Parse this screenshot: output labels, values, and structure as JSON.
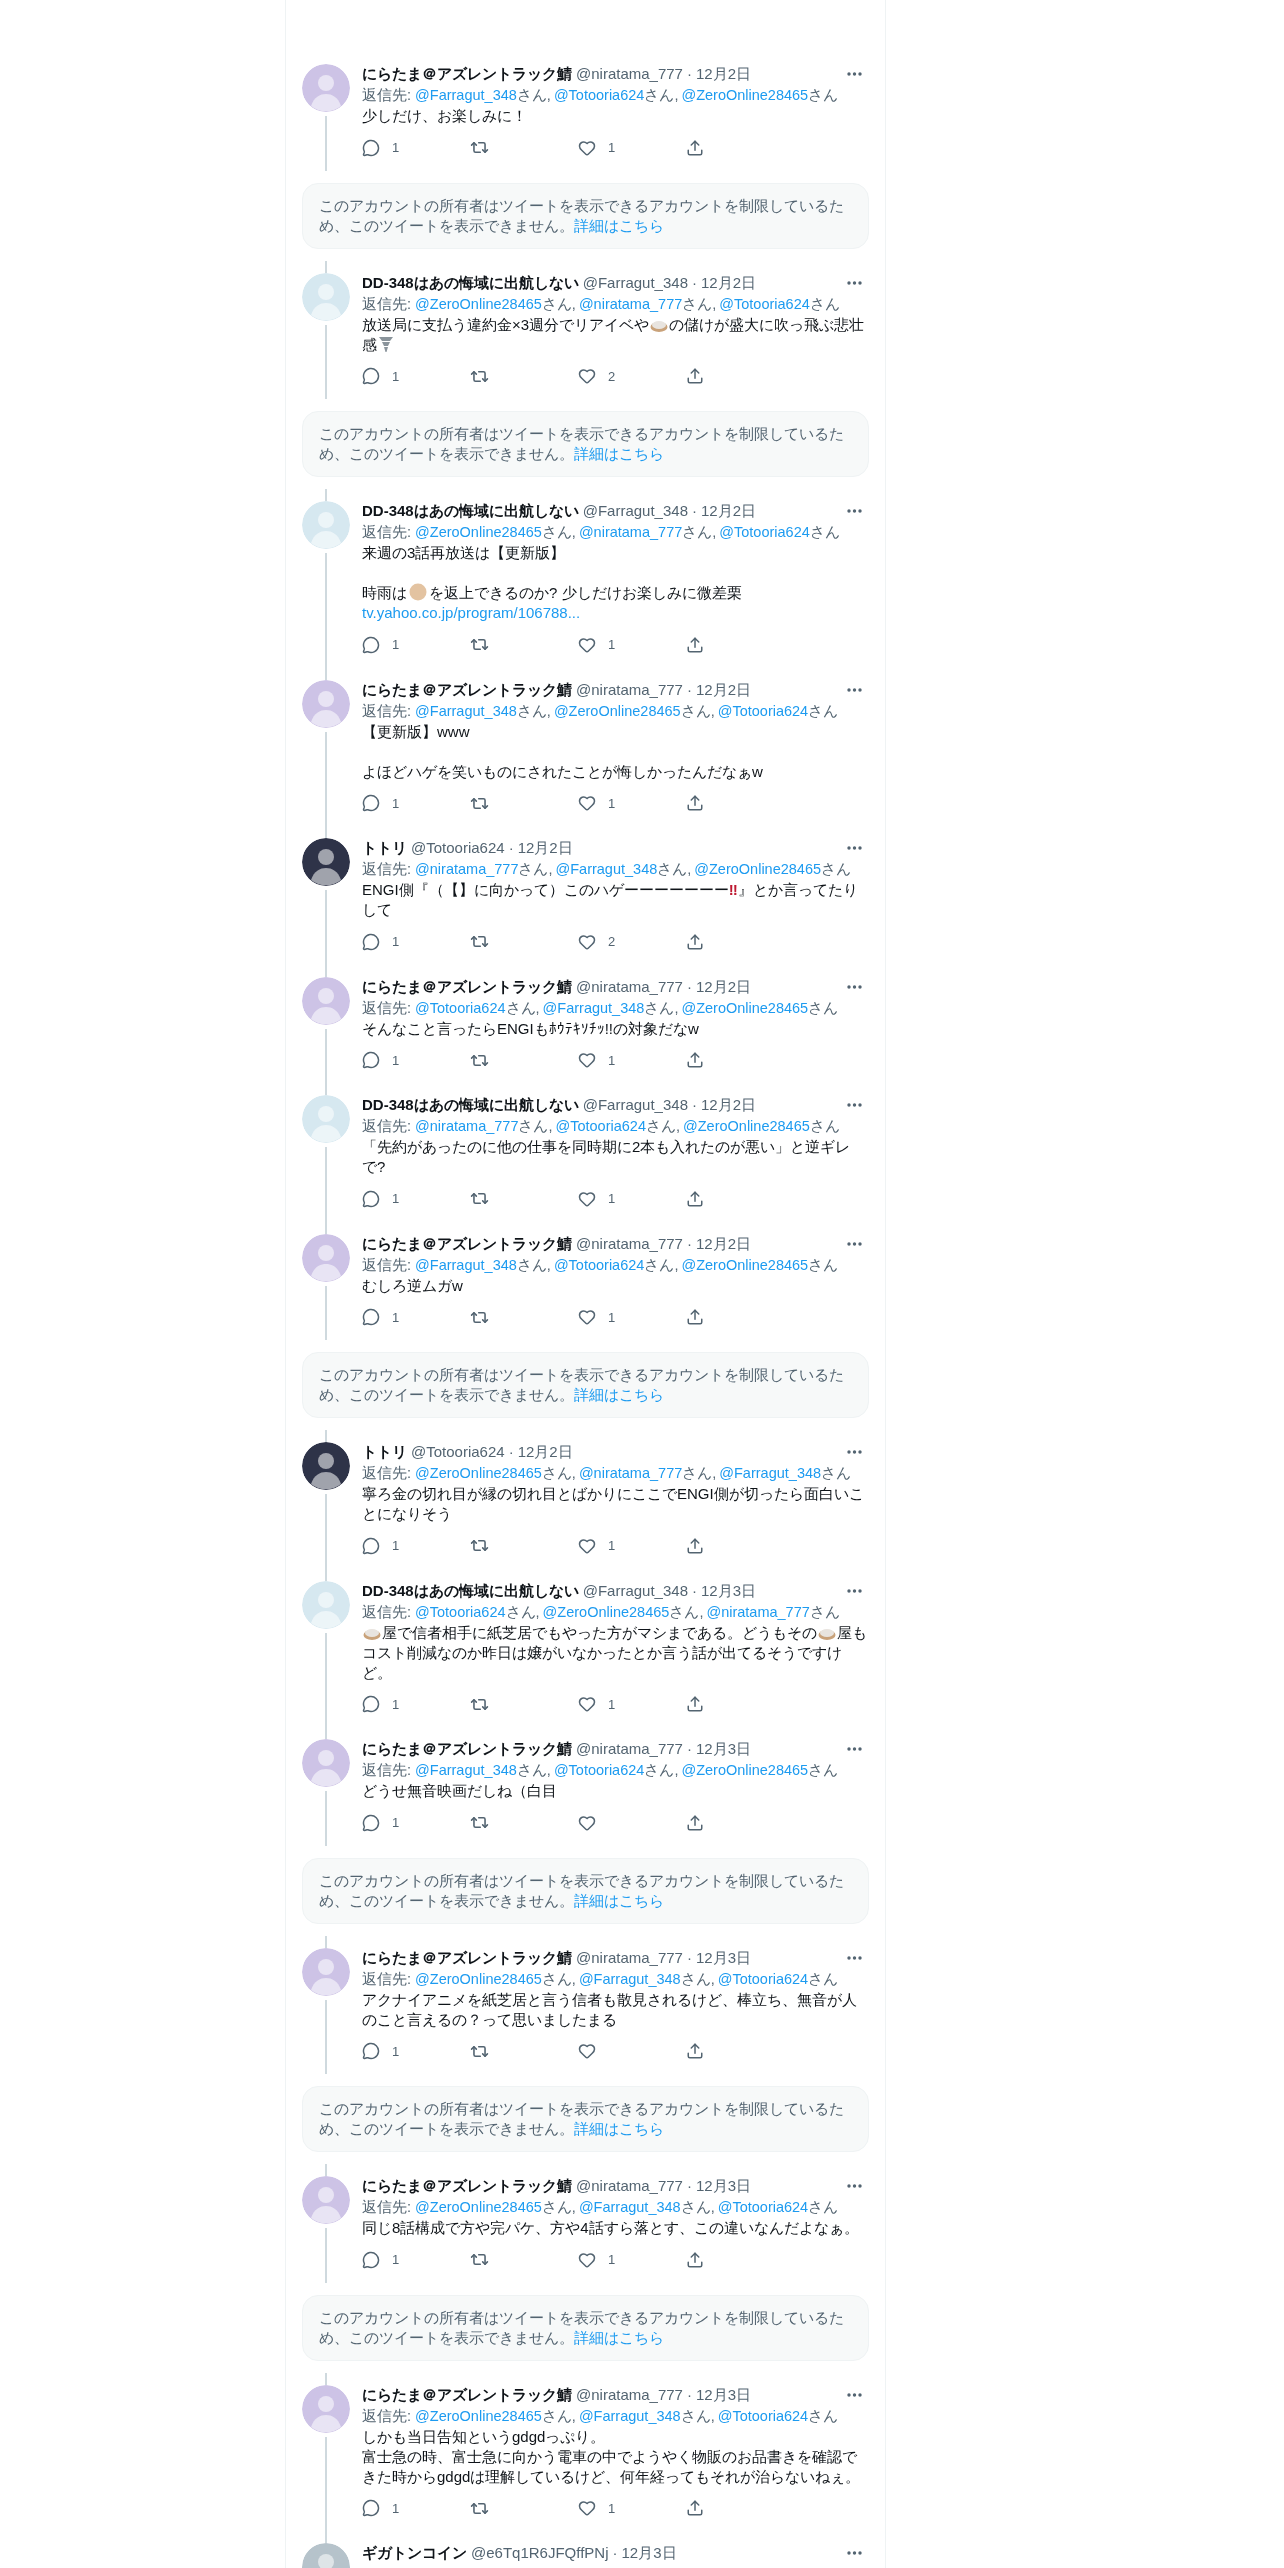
{
  "thread": [
    {
      "kind": "tweet",
      "color": "#cdc3e6",
      "name": "にらたま＠アズレントラック鯖",
      "handle": "@niratama_777",
      "sep": "·",
      "date": "12月2日",
      "reply_label": "返信先:",
      "mentions": [
        {
          "handle": "@Farragut_348",
          "suffix": "さん,"
        },
        {
          "handle": "@Totooria624",
          "suffix": "さん,"
        },
        {
          "handle": "@ZeroOnline28465",
          "suffix": "さん"
        }
      ],
      "body": [
        {
          "kind": "line",
          "parts": [
            {
              "kind": "text",
              "text": "少しだけ、お楽しみに！"
            }
          ]
        }
      ],
      "replies": "1",
      "likes": "1"
    },
    {
      "kind": "notice",
      "text": "このアカウントの所有者はツイートを表示できるアカウントを制限しているため、このツイートを表示できません。",
      "link": "詳細はこちら"
    },
    {
      "kind": "tweet",
      "color": "#d6e8f0",
      "name": "DD-348はあの悔域に出航しない",
      "handle": "@Farragut_348",
      "sep": "·",
      "date": "12月2日",
      "reply_label": "返信先:",
      "mentions": [
        {
          "handle": "@ZeroOnline28465",
          "suffix": "さん,"
        },
        {
          "handle": "@niratama_777",
          "suffix": "さん,"
        },
        {
          "handle": "@Totooria624",
          "suffix": "さん"
        }
      ],
      "body": [
        {
          "kind": "line",
          "parts": [
            {
              "kind": "text",
              "text": "放送局に支払う違約金×3週分でリアイベや"
            },
            {
              "kind": "dish"
            },
            {
              "kind": "text",
              "text": "の儲けが盛大に吹っ飛ぶ悲壮感"
            },
            {
              "kind": "tornado"
            }
          ]
        }
      ],
      "replies": "1",
      "likes": "2"
    },
    {
      "kind": "notice",
      "text": "このアカウントの所有者はツイートを表示できるアカウントを制限しているため、このツイートを表示できません。",
      "link": "詳細はこちら"
    },
    {
      "kind": "tweet",
      "color": "#d6e8f0",
      "name": "DD-348はあの悔域に出航しない",
      "handle": "@Farragut_348",
      "sep": "·",
      "date": "12月2日",
      "reply_label": "返信先:",
      "mentions": [
        {
          "handle": "@ZeroOnline28465",
          "suffix": "さん,"
        },
        {
          "handle": "@niratama_777",
          "suffix": "さん,"
        },
        {
          "handle": "@Totooria624",
          "suffix": "さん"
        }
      ],
      "body": [
        {
          "kind": "line",
          "parts": [
            {
              "kind": "text",
              "text": "来週の3話再放送は【更新版】"
            }
          ]
        },
        {
          "kind": "blank"
        },
        {
          "kind": "line",
          "parts": [
            {
              "kind": "text",
              "text": "時雨は"
            },
            {
              "kind": "face"
            },
            {
              "kind": "text",
              "text": "を返上できるのか? 少しだけお楽しみに微差栗"
            }
          ]
        },
        {
          "kind": "url",
          "text": "tv.yahoo.co.jp/program/106788..."
        }
      ],
      "replies": "1",
      "likes": "1"
    },
    {
      "kind": "tweet",
      "color": "#cdc3e6",
      "name": "にらたま＠アズレントラック鯖",
      "handle": "@niratama_777",
      "sep": "·",
      "date": "12月2日",
      "reply_label": "返信先:",
      "mentions": [
        {
          "handle": "@Farragut_348",
          "suffix": "さん,"
        },
        {
          "handle": "@ZeroOnline28465",
          "suffix": "さん,"
        },
        {
          "handle": "@Totooria624",
          "suffix": "さん"
        }
      ],
      "body": [
        {
          "kind": "line",
          "parts": [
            {
              "kind": "text",
              "text": "【更新版】www"
            }
          ]
        },
        {
          "kind": "blank"
        },
        {
          "kind": "line",
          "parts": [
            {
              "kind": "text",
              "text": "よほどハゲを笑いものにされたことが悔しかったんだなぁw"
            }
          ]
        }
      ],
      "replies": "1",
      "likes": "1"
    },
    {
      "kind": "tweet",
      "color": "#2e3348",
      "name": "トトリ",
      "handle": "@Totooria624",
      "sep": "·",
      "date": "12月2日",
      "reply_label": "返信先:",
      "mentions": [
        {
          "handle": "@niratama_777",
          "suffix": "さん,"
        },
        {
          "handle": "@Farragut_348",
          "suffix": "さん,"
        },
        {
          "handle": "@ZeroOnline28465",
          "suffix": "さん"
        }
      ],
      "body": [
        {
          "kind": "line",
          "parts": [
            {
              "kind": "text",
              "text": "ENGI側『（【】に向かって）このハゲーーーーーーー"
            },
            {
              "kind": "red",
              "text": "‼"
            },
            {
              "kind": "text",
              "text": "』とか言ってたりして"
            }
          ]
        }
      ],
      "replies": "1",
      "likes": "2"
    },
    {
      "kind": "tweet",
      "color": "#cdc3e6",
      "name": "にらたま＠アズレントラック鯖",
      "handle": "@niratama_777",
      "sep": "·",
      "date": "12月2日",
      "reply_label": "返信先:",
      "mentions": [
        {
          "handle": "@Totooria624",
          "suffix": "さん,"
        },
        {
          "handle": "@Farragut_348",
          "suffix": "さん,"
        },
        {
          "handle": "@ZeroOnline28465",
          "suffix": "さん"
        }
      ],
      "body": [
        {
          "kind": "line",
          "parts": [
            {
              "kind": "text",
              "text": "そんなこと言ったらENGIもﾎｳﾃｷｿﾁｯ!!の対象だなw"
            }
          ]
        }
      ],
      "replies": "1",
      "likes": "1"
    },
    {
      "kind": "tweet",
      "color": "#d6e8f0",
      "name": "DD-348はあの悔域に出航しない",
      "handle": "@Farragut_348",
      "sep": "·",
      "date": "12月2日",
      "reply_label": "返信先:",
      "mentions": [
        {
          "handle": "@niratama_777",
          "suffix": "さん,"
        },
        {
          "handle": "@Totooria624",
          "suffix": "さん,"
        },
        {
          "handle": "@ZeroOnline28465",
          "suffix": "さん"
        }
      ],
      "body": [
        {
          "kind": "line",
          "parts": [
            {
              "kind": "text",
              "text": "「先約があったのに他の仕事を同時期に2本も入れたのが悪い」と逆ギレで?"
            }
          ]
        }
      ],
      "replies": "1",
      "likes": "1"
    },
    {
      "kind": "tweet",
      "color": "#cdc3e6",
      "name": "にらたま＠アズレントラック鯖",
      "handle": "@niratama_777",
      "sep": "·",
      "date": "12月2日",
      "reply_label": "返信先:",
      "mentions": [
        {
          "handle": "@Farragut_348",
          "suffix": "さん,"
        },
        {
          "handle": "@Totooria624",
          "suffix": "さん,"
        },
        {
          "handle": "@ZeroOnline28465",
          "suffix": "さん"
        }
      ],
      "body": [
        {
          "kind": "line",
          "parts": [
            {
              "kind": "text",
              "text": "むしろ逆ムガw"
            }
          ]
        }
      ],
      "replies": "1",
      "likes": "1"
    },
    {
      "kind": "notice",
      "text": "このアカウントの所有者はツイートを表示できるアカウントを制限しているため、このツイートを表示できません。",
      "link": "詳細はこちら"
    },
    {
      "kind": "tweet",
      "color": "#2e3348",
      "name": "トトリ",
      "handle": "@Totooria624",
      "sep": "·",
      "date": "12月2日",
      "reply_label": "返信先:",
      "mentions": [
        {
          "handle": "@ZeroOnline28465",
          "suffix": "さん,"
        },
        {
          "handle": "@niratama_777",
          "suffix": "さん,"
        },
        {
          "handle": "@Farragut_348",
          "suffix": "さん"
        }
      ],
      "body": [
        {
          "kind": "line",
          "parts": [
            {
              "kind": "text",
              "text": "寧ろ金の切れ目が縁の切れ目とばかりにここでENGI側が切ったら面白いことになりそう"
            }
          ]
        }
      ],
      "replies": "1",
      "likes": "1"
    },
    {
      "kind": "tweet",
      "color": "#d6e8f0",
      "name": "DD-348はあの悔域に出航しない",
      "handle": "@Farragut_348",
      "sep": "·",
      "date": "12月3日",
      "reply_label": "返信先:",
      "mentions": [
        {
          "handle": "@Totooria624",
          "suffix": "さん,"
        },
        {
          "handle": "@ZeroOnline28465",
          "suffix": "さん,"
        },
        {
          "handle": "@niratama_777",
          "suffix": "さん"
        }
      ],
      "body": [
        {
          "kind": "line",
          "parts": [
            {
              "kind": "dish"
            },
            {
              "kind": "text",
              "text": "屋で信者相手に紙芝居でもやった方がマシまである。どうもその"
            },
            {
              "kind": "dish"
            },
            {
              "kind": "text",
              "text": "屋もコスト削減なのか昨日は嬢がいなかったとか言う話が出てるそうですけど。"
            }
          ]
        }
      ],
      "replies": "1",
      "likes": "1"
    },
    {
      "kind": "tweet",
      "color": "#cdc3e6",
      "name": "にらたま＠アズレントラック鯖",
      "handle": "@niratama_777",
      "sep": "·",
      "date": "12月3日",
      "reply_label": "返信先:",
      "mentions": [
        {
          "handle": "@Farragut_348",
          "suffix": "さん,"
        },
        {
          "handle": "@Totooria624",
          "suffix": "さん,"
        },
        {
          "handle": "@ZeroOnline28465",
          "suffix": "さん"
        }
      ],
      "body": [
        {
          "kind": "line",
          "parts": [
            {
              "kind": "text",
              "text": "どうせ無音映画だしね（白目"
            }
          ]
        }
      ],
      "replies": "1"
    },
    {
      "kind": "notice",
      "text": "このアカウントの所有者はツイートを表示できるアカウントを制限しているため、このツイートを表示できません。",
      "link": "詳細はこちら"
    },
    {
      "kind": "tweet",
      "color": "#cdc3e6",
      "name": "にらたま＠アズレントラック鯖",
      "handle": "@niratama_777",
      "sep": "·",
      "date": "12月3日",
      "reply_label": "返信先:",
      "mentions": [
        {
          "handle": "@ZeroOnline28465",
          "suffix": "さん,"
        },
        {
          "handle": "@Farragut_348",
          "suffix": "さん,"
        },
        {
          "handle": "@Totooria624",
          "suffix": "さん"
        }
      ],
      "body": [
        {
          "kind": "line",
          "parts": [
            {
              "kind": "text",
              "text": "アクナイアニメを紙芝居と言う信者も散見されるけど、棒立ち、無音が人のこと言えるの？って思いましたまる"
            }
          ]
        }
      ],
      "replies": "1"
    },
    {
      "kind": "notice",
      "text": "このアカウントの所有者はツイートを表示できるアカウントを制限しているため、このツイートを表示できません。",
      "link": "詳細はこちら"
    },
    {
      "kind": "tweet",
      "color": "#cdc3e6",
      "name": "にらたま＠アズレントラック鯖",
      "handle": "@niratama_777",
      "sep": "·",
      "date": "12月3日",
      "reply_label": "返信先:",
      "mentions": [
        {
          "handle": "@ZeroOnline28465",
          "suffix": "さん,"
        },
        {
          "handle": "@Farragut_348",
          "suffix": "さん,"
        },
        {
          "handle": "@Totooria624",
          "suffix": "さん"
        }
      ],
      "body": [
        {
          "kind": "line",
          "parts": [
            {
              "kind": "text",
              "text": "同じ8話構成で方や完パケ、方や4話すら落とす、この違いなんだよなぁ。"
            }
          ]
        }
      ],
      "replies": "1",
      "likes": "1"
    },
    {
      "kind": "notice",
      "text": "このアカウントの所有者はツイートを表示できるアカウントを制限しているため、このツイートを表示できません。",
      "link": "詳細はこちら"
    },
    {
      "kind": "tweet",
      "color": "#cdc3e6",
      "name": "にらたま＠アズレントラック鯖",
      "handle": "@niratama_777",
      "sep": "·",
      "date": "12月3日",
      "reply_label": "返信先:",
      "mentions": [
        {
          "handle": "@ZeroOnline28465",
          "suffix": "さん,"
        },
        {
          "handle": "@Farragut_348",
          "suffix": "さん,"
        },
        {
          "handle": "@Totooria624",
          "suffix": "さん"
        }
      ],
      "body": [
        {
          "kind": "line",
          "parts": [
            {
              "kind": "text",
              "text": "しかも当日告知というgdgdっぷり。"
            }
          ]
        },
        {
          "kind": "line",
          "parts": [
            {
              "kind": "text",
              "text": "富士急の時、富士急に向かう電車の中でようやく物販のお品書きを確認できた時からgdgdは理解しているけど、何年経ってもそれが治らないねぇ。"
            }
          ]
        }
      ],
      "replies": "1",
      "likes": "1"
    },
    {
      "kind": "tweet",
      "color": "#b6c3cb",
      "name": "ギガトンコイン",
      "handle": "@e6Tq1R6JFQffPNj",
      "sep": "·",
      "date": "12月3日"
    }
  ]
}
